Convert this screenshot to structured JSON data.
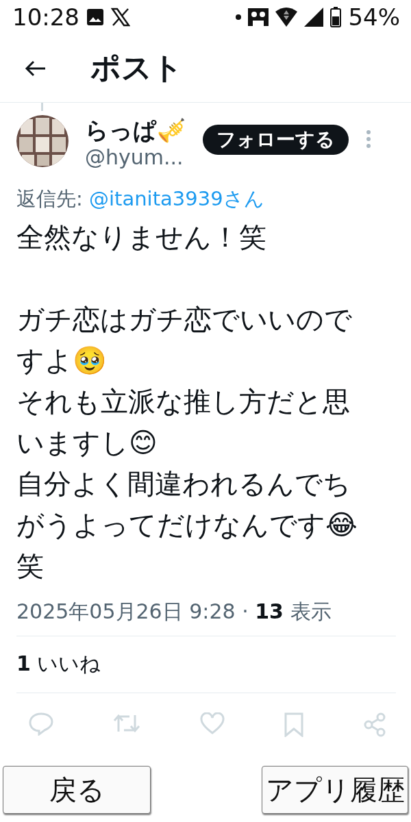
{
  "status_bar": {
    "time": "10:28",
    "battery": "54%"
  },
  "header": {
    "title": "ポスト"
  },
  "post": {
    "name": "らっぱ🎺",
    "handle": "@hyum...",
    "follow_button": "フォローする",
    "reply_to": {
      "label": "返信先:",
      "user": "@itanita3939さん"
    },
    "paragraphs": [
      "全然なりません！笑",
      "ガチ恋はガチ恋でいいのですよ🥹\nそれも立派な推し方だと思いますし😊\n自分よく間違われるんでちがうよってだけなんです😂笑"
    ],
    "timestamp": "2025年05月26日 9:28 · ",
    "views_count": "13",
    "views_label": " 表示",
    "likes_count": "1",
    "likes_label": " いいね"
  },
  "nav_buttons": [
    "戻る",
    "アプリ履歴"
  ]
}
